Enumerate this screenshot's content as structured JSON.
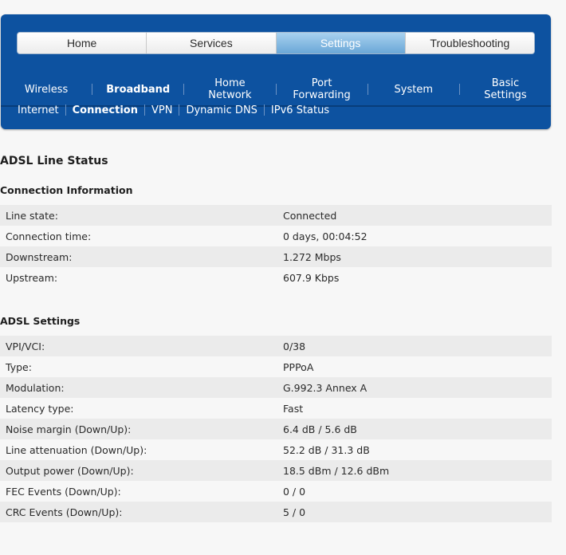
{
  "tabs": [
    {
      "label": "Home",
      "active": false
    },
    {
      "label": "Services",
      "active": false
    },
    {
      "label": "Settings",
      "active": true
    },
    {
      "label": "Troubleshooting",
      "active": false
    }
  ],
  "subnav": [
    {
      "label": "Wireless",
      "bold": false
    },
    {
      "label": "Broadband",
      "bold": true
    },
    {
      "label": "Home\nNetwork",
      "bold": false
    },
    {
      "label": "Port\nForwarding",
      "bold": false
    },
    {
      "label": "System",
      "bold": false
    },
    {
      "label": "Basic\nSettings",
      "bold": false
    }
  ],
  "thirdnav": [
    {
      "label": "Internet",
      "bold": false
    },
    {
      "label": "Connection",
      "bold": true
    },
    {
      "label": "VPN",
      "bold": false
    },
    {
      "label": "Dynamic DNS",
      "bold": false
    },
    {
      "label": "IPv6 Status",
      "bold": false
    }
  ],
  "page_title": "ADSL Line Status",
  "sections": [
    {
      "title": "Connection Information",
      "rows": [
        {
          "label": "Line state:",
          "value": "Connected"
        },
        {
          "label": "Connection time:",
          "value": "0 days, 00:04:52"
        },
        {
          "label": "Downstream:",
          "value": "1.272 Mbps"
        },
        {
          "label": "Upstream:",
          "value": "607.9 Kbps"
        }
      ]
    },
    {
      "title": "ADSL Settings",
      "rows": [
        {
          "label": "VPI/VCI:",
          "value": "0/38"
        },
        {
          "label": "Type:",
          "value": "PPPoA"
        },
        {
          "label": "Modulation:",
          "value": "G.992.3 Annex A"
        },
        {
          "label": "Latency type:",
          "value": "Fast"
        },
        {
          "label": "Noise margin (Down/Up):",
          "value": "6.4 dB / 5.6 dB"
        },
        {
          "label": "Line attenuation (Down/Up):",
          "value": "52.2 dB / 31.3 dB"
        },
        {
          "label": "Output power (Down/Up):",
          "value": "18.5 dBm / 12.6 dBm"
        },
        {
          "label": "FEC Events (Down/Up):",
          "value": "0 / 0"
        },
        {
          "label": "CRC Events (Down/Up):",
          "value": "5 / 0"
        }
      ]
    }
  ],
  "colors": {
    "header_blue": "#0d52a0",
    "active_tab": "#6aa7d7"
  }
}
